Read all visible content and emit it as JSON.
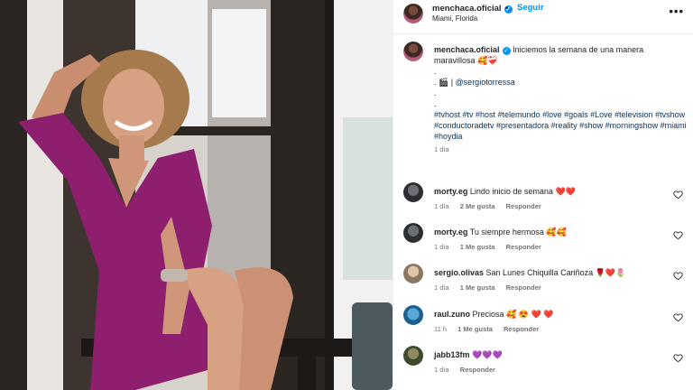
{
  "post": {
    "username": "menchaca.oficial",
    "follow_label": "Seguir",
    "separator": "•",
    "location": "Miami, Florida",
    "more_label": "•••"
  },
  "caption": {
    "username": "menchaca.oficial",
    "text_line1": "Iniciemos la semana de una manera",
    "text_line2": "maravillosa",
    "emojis": "🥰❤️‍🩹",
    "dot1": ".",
    "credit_prefix": ". 🎬 | ",
    "credit_handle": "@sergiotorressa",
    "dot2": ".",
    "dot3": ".",
    "hashtags": "#tvhost #tv #host #telemundo #love #goals #Love #television #tvshow #conductoradetv #presentadora #reality #show #morningshow #miami #hoydia",
    "time": "1 día"
  },
  "comments": [
    {
      "username": "morty.eg",
      "text": "Lindo inicio de semana",
      "emojis": "❤️❤️",
      "time": "1 día",
      "likes": "2 Me gusta",
      "reply": "Responder"
    },
    {
      "username": "morty.eg",
      "text": "Tu siempre hermosa",
      "emojis": "🥰🥰",
      "time": "1 día",
      "likes": "1 Me gusta",
      "reply": "Responder"
    },
    {
      "username": "sergio.olivas",
      "text": "San Lunes Chiquilla Cariñoza",
      "emojis": "🌹❤️🌷",
      "time": "1 día",
      "likes": "1 Me gusta",
      "reply": "Responder"
    },
    {
      "username": "raul.zuno",
      "text": "Preciosa",
      "emojis": "🥰 😍 ❤️ ❤️",
      "time": "11 h",
      "likes": "1 Me gusta",
      "reply": "Responder"
    },
    {
      "username": "jabb13fm",
      "text": "",
      "emojis": "💜💜💜",
      "time": "1 día",
      "likes": "",
      "reply": "Responder"
    }
  ],
  "colors": {
    "link": "#00376b",
    "accent": "#0095f6",
    "meta": "#737373",
    "dress": "#8e1f6e"
  }
}
